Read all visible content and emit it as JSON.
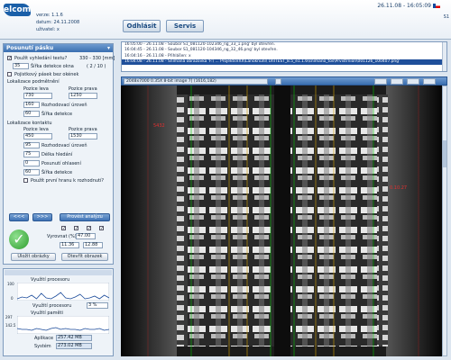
{
  "header": {
    "logo": "elcom",
    "version_label": "verze:",
    "version": "1.1.6",
    "date_label": "datum:",
    "date": "24.11.2008",
    "user_label": "uživatel:",
    "user": "x",
    "logout_label": "Odhlásit",
    "service_label": "Servis",
    "datetime": "26.11.08 - 16:05:09",
    "user_code": "S1"
  },
  "left_panel": {
    "title": "Posunutí pásku",
    "use_offset_label": "Použít vyhledání textu?",
    "offset_range": "330 - 330 [mm]",
    "detection_value": "35",
    "detection_label": "Šířka detekce okna",
    "detection_range": "( 2 / 10 )",
    "horizontal_label": "Pojistkový pásek bez okének",
    "sub1_label": "Lokalizace podmětnění",
    "left_edge": "Pozice leva",
    "right_edge": "Pozice prava",
    "loc_left": "730",
    "loc_right": "1250",
    "loc_dist_val": "160",
    "loc_dist_label": "Rozhodovací úroveň",
    "loc_width_val": "60",
    "loc_width_label": "Šířka detekce",
    "sub2_label": "Lokalizace kontaktu",
    "k_left": "450",
    "k_right": "1530",
    "k_level_val": "95",
    "k_level_label": "Rozhodovací úroveň",
    "k_len_val": "75",
    "k_len_label": "Délka hledání",
    "k_count_val": "0",
    "k_count_label": "Posunutí ohlasení",
    "k_width_val": "60",
    "k_width_label": "Šířka detekce",
    "k_extra_label": "Použít první hranu k rozhodnutí?",
    "btn_a": "<<<",
    "btn_b": ">>>",
    "btn_analysis": "Provést analýzu",
    "counts_label": "Vyrovnat (%)",
    "counts_value": "47.00",
    "val1": "11.36",
    "val2": "12.88",
    "save_label": "Uložit obrázky",
    "open_label": "Otevřít obrazek"
  },
  "monitor": {
    "proc_label": "Využití procesoru",
    "scale_top": "100",
    "scale_zero": "0",
    "proc_val_label": "Využití procesoru",
    "proc_val": "3 %",
    "mem_label": "Využití paměti",
    "mem_scale_top": "297",
    "mem_scale_mid": "142.5",
    "app_label": "Aplikace",
    "app_val": "257.42 MB",
    "sys_label": "Systém",
    "sys_val": "273.02 MB",
    "mem_series_top": [
      6,
      5,
      5,
      4,
      6,
      5,
      4,
      6,
      7,
      5,
      6,
      5,
      5,
      4,
      6,
      5,
      5,
      6,
      4,
      5
    ],
    "proc_series": [
      2,
      4,
      3,
      6,
      2,
      8,
      3,
      2,
      5,
      9,
      3,
      2,
      4,
      7,
      2,
      3,
      5,
      2,
      6,
      3
    ]
  },
  "log": {
    "lines": [
      "16:05:00 - 26.11.08 - Soubor  S1_081120-102346_ng_33_1.png' byl otevřen.",
      "16:04:45 - 26.11.08 - Soubor  S1_081120-104346_ng_32_46.png' byl otevřen.",
      "16:04:16 - 26.11.08 - Přihlášen: x",
      "16:04:08 - 26.11.08 - Snímaná obrazovka 'F:\\ ... ProjektsVXX\\Lanoknuní\\  UnITEST_8.5_e1.1.6\\snímano_tos\\Prvistrnion\\001126_100407.png'"
    ]
  },
  "viewer": {
    "info": "2048x7000 0.35X 8-bit image 7] (1616,182)",
    "marker_left": "5432",
    "marker_right": "0.10.27"
  },
  "colors": {
    "accent": "#3a6fb0",
    "panel_bg": "#eef3f8",
    "ok_green": "#2e9e2e"
  }
}
